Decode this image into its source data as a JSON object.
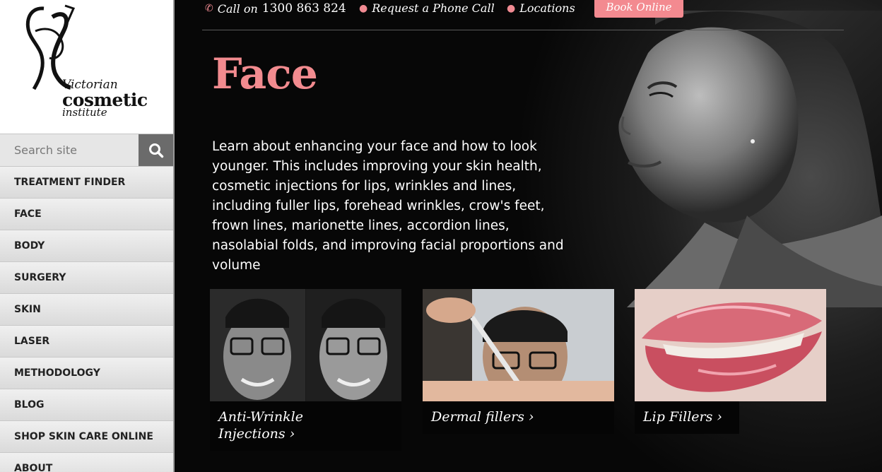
{
  "logo": {
    "line1": "Victorian",
    "line2": "cosmetic",
    "line3": "institute"
  },
  "search": {
    "placeholder": "Search site",
    "icon": "search-icon"
  },
  "nav": [
    "TREATMENT FINDER",
    "FACE",
    "BODY",
    "SURGERY",
    "SKIN",
    "LASER",
    "METHODOLOGY",
    "BLOG",
    "SHOP SKIN CARE ONLINE",
    "ABOUT"
  ],
  "topbar": {
    "call_prefix": "Call on",
    "phone": "1300 863 824",
    "request_call": "Request a Phone Call",
    "locations": "Locations",
    "book": "Book Online"
  },
  "hero": {
    "title": "Face",
    "description": "Learn about enhancing your face and how to look younger. This includes improving your skin health, cosmetic injections for lips, wrinkles and lines, including fuller lips, forehead wrinkles, crow's feet, frown lines, marionette lines, accordion lines, nasolabial folds, and improving facial proportions and volume"
  },
  "cards": [
    {
      "label_line1": "Anti-Wrinkle",
      "label_line2": "Injections ›"
    },
    {
      "label_line1": "Dermal fillers ›"
    },
    {
      "label_line1": "Lip Fillers ›"
    }
  ],
  "colors": {
    "accent": "#f38a90",
    "sidebar": "#e8e8e8",
    "background": "#000000"
  }
}
